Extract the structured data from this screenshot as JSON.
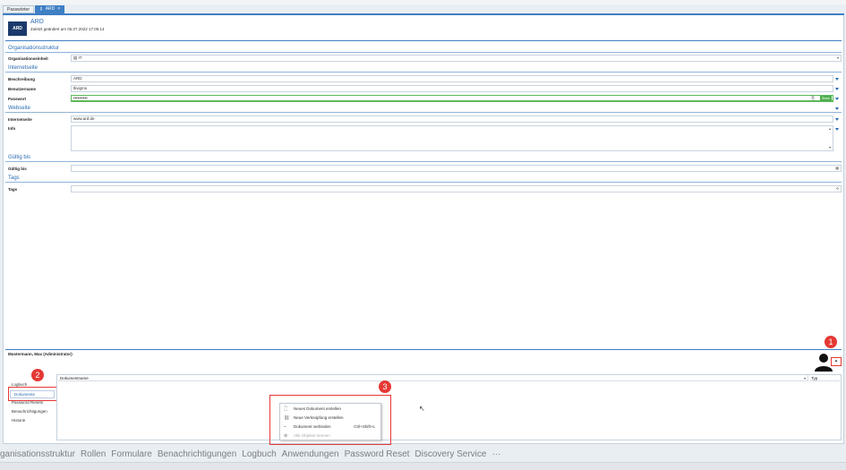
{
  "tabs": [
    {
      "label": "Passwörter"
    },
    {
      "label": "ARD",
      "close": "×"
    }
  ],
  "record": {
    "logo": "ARD",
    "title": "ARD",
    "subtitle": "Zuletzt geändert am 06.07.2022 17:05:14"
  },
  "sections": {
    "org": {
      "title": "Organisationsstruktur",
      "unit_label": "Organisationseinheit",
      "unit_value": "IT"
    },
    "internet": {
      "title": "Internetseite",
      "desc_label": "Beschreibung",
      "desc_value": "ARD",
      "user_label": "Benutzername",
      "user_value": "tlivigms",
      "pw_label": "Passwort",
      "pw_value": "••••••••••",
      "strength": "Stark"
    },
    "website": {
      "title": "Webseite",
      "url_label": "Internetseite",
      "url_value": "www.ard.de",
      "info_label": "Info"
    },
    "valid": {
      "title": "Gültig bis",
      "label": "Gültig bis"
    },
    "tags": {
      "title": "Tags",
      "label": "Tags"
    }
  },
  "owner": "Mustermann, Max (Administrator)",
  "markers": [
    "1",
    "2",
    "3"
  ],
  "nav": [
    {
      "label": "Logbuch"
    },
    {
      "label": "Dokumente",
      "selected": true
    },
    {
      "label": "Password Resets"
    },
    {
      "label": "Benachrichtigungen"
    },
    {
      "label": "Historie"
    }
  ],
  "docs": {
    "col_name": "Dokumentname",
    "col_type": "Typ"
  },
  "context_menu": [
    {
      "label": "Neues Dokument erstellen",
      "icon": "new-document-icon",
      "shortcut": "",
      "disabled": false
    },
    {
      "label": "Neue Verknüpfung erstellen",
      "icon": "link-icon",
      "shortcut": "",
      "disabled": false
    },
    {
      "label": "Dokument verbinden",
      "icon": "paperclip-icon",
      "shortcut": "Ctrl+Shift+L",
      "disabled": false
    },
    {
      "label": "Alle Objekte trennen",
      "icon": "unlink-icon",
      "shortcut": "",
      "disabled": true
    }
  ],
  "modules": [
    "ganisationsstruktur",
    "Rollen",
    "Formulare",
    "Benachrichtigungen",
    "Logbuch",
    "Anwendungen",
    "Password Reset",
    "Discovery Service",
    "···"
  ],
  "colors": {
    "accent": "#3f7fc4",
    "marker": "#e53935",
    "strength": "#4cae4c"
  }
}
